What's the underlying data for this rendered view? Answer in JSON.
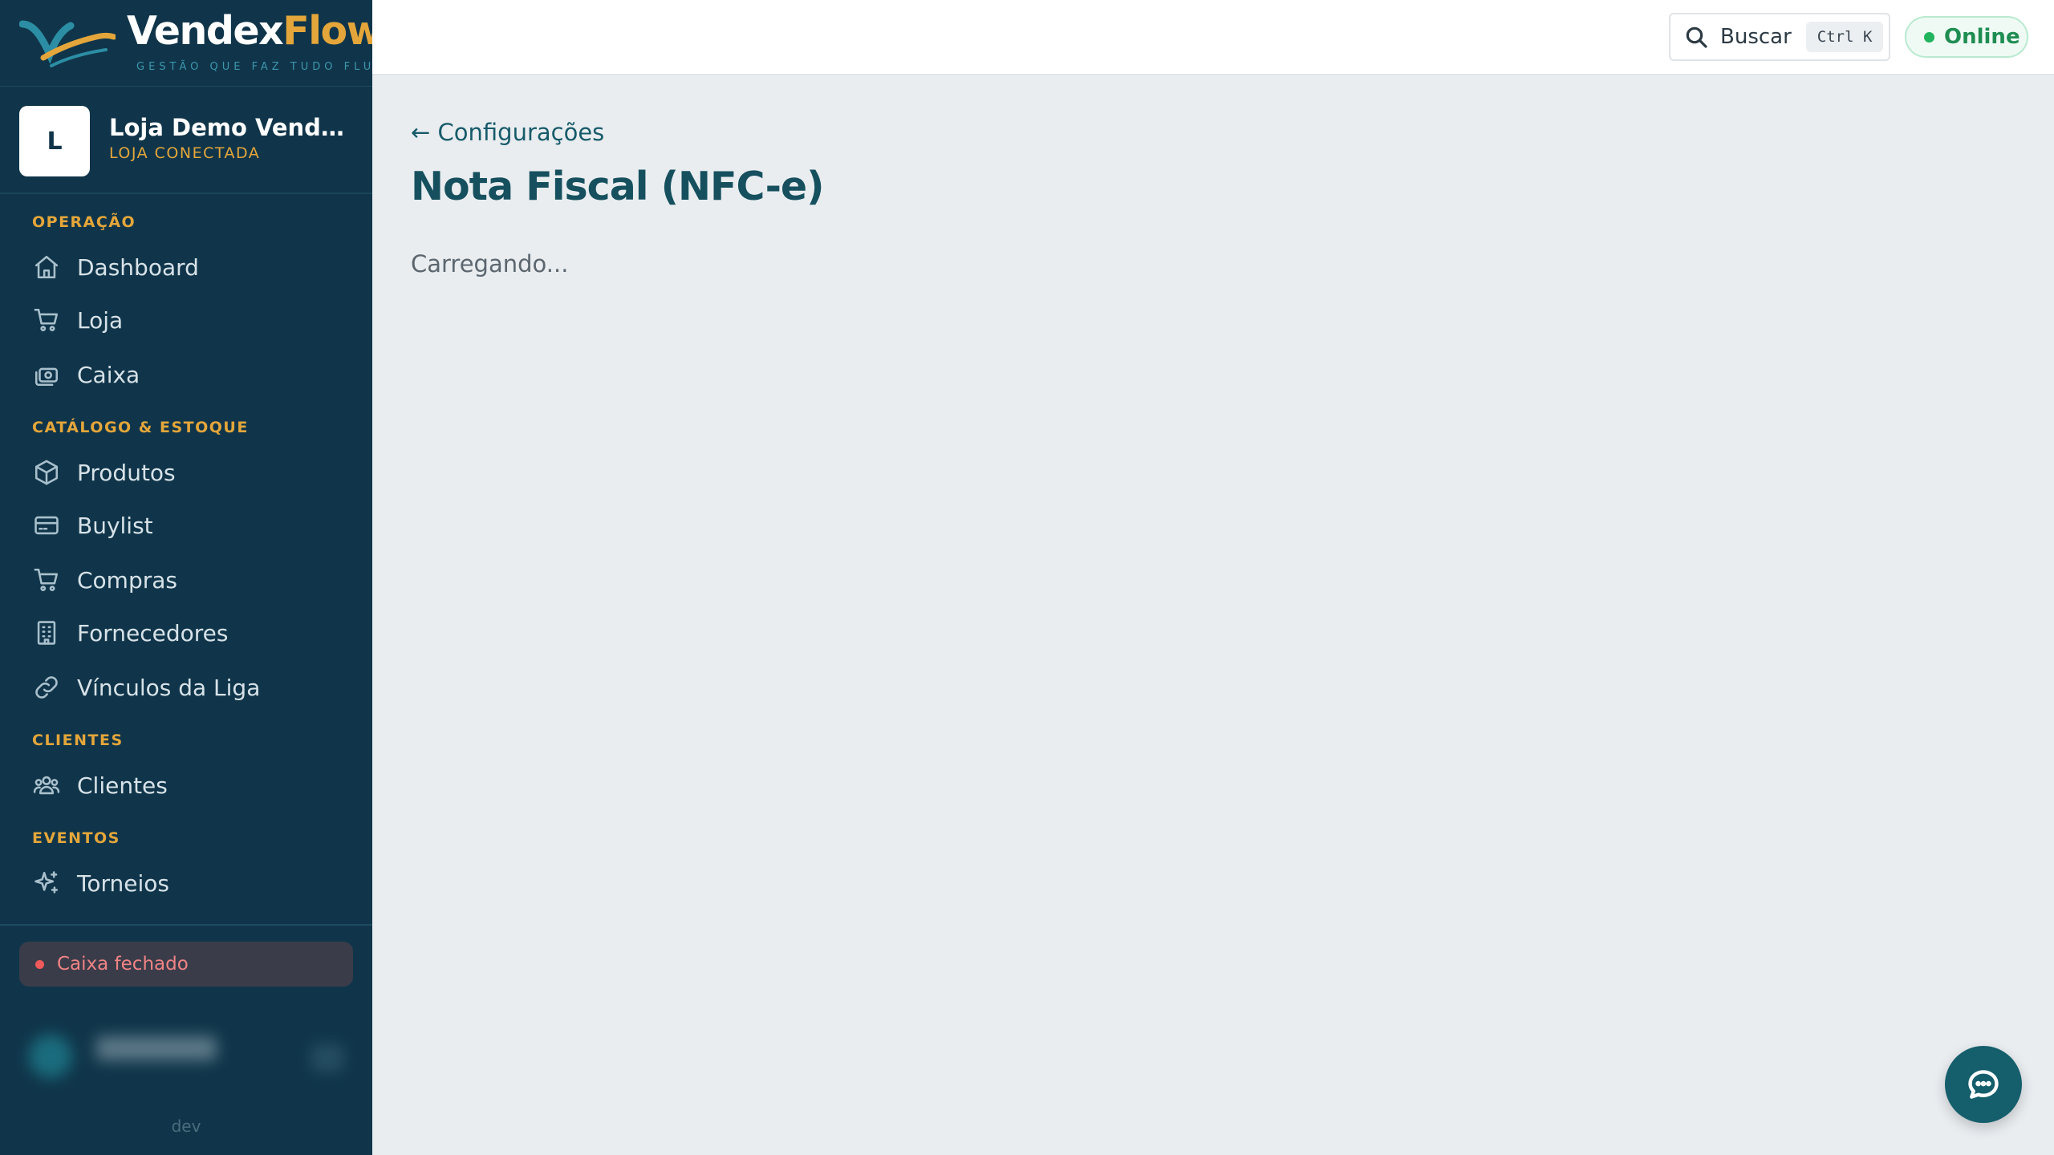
{
  "brand": {
    "name_main": "Vendex",
    "name_accent": "Flow",
    "tagline": "GESTÃO QUE FAZ TUDO FLUIR",
    "accent_color": "#e4a63a"
  },
  "store": {
    "avatar_letter": "L",
    "name": "Loja Demo VendexFlow",
    "status": "LOJA CONECTADA"
  },
  "sidebar": {
    "sections": [
      {
        "title": "OPERAÇÃO"
      },
      {
        "title": "CATÁLOGO & ESTOQUE"
      },
      {
        "title": "CLIENTES"
      },
      {
        "title": "EVENTOS"
      }
    ],
    "items": [
      {
        "label": "Dashboard",
        "icon": "home-icon"
      },
      {
        "label": "Loja",
        "icon": "cart-icon"
      },
      {
        "label": "Caixa",
        "icon": "cash-register-icon"
      },
      {
        "label": "Produtos",
        "icon": "box-icon"
      },
      {
        "label": "Buylist",
        "icon": "card-icon"
      },
      {
        "label": "Compras",
        "icon": "cart-icon"
      },
      {
        "label": "Fornecedores",
        "icon": "building-icon"
      },
      {
        "label": "Vínculos da Liga",
        "icon": "link-icon"
      },
      {
        "label": "Clientes",
        "icon": "users-icon"
      },
      {
        "label": "Torneios",
        "icon": "sparkles-icon"
      }
    ],
    "cash_status": "Caixa fechado",
    "env_label": "dev"
  },
  "header": {
    "search_label": "Buscar",
    "search_shortcut": "Ctrl K",
    "connection_status": "Online"
  },
  "main": {
    "back_link": "← Configurações",
    "title": "Nota Fiscal (NFC-e)",
    "loading_text": "Carregando..."
  },
  "colors": {
    "sidebar_bg": "#10354a",
    "page_bg": "#e9edf0",
    "title": "#16505e",
    "online": "#1f8d52",
    "cash_closed": "#f08484"
  }
}
